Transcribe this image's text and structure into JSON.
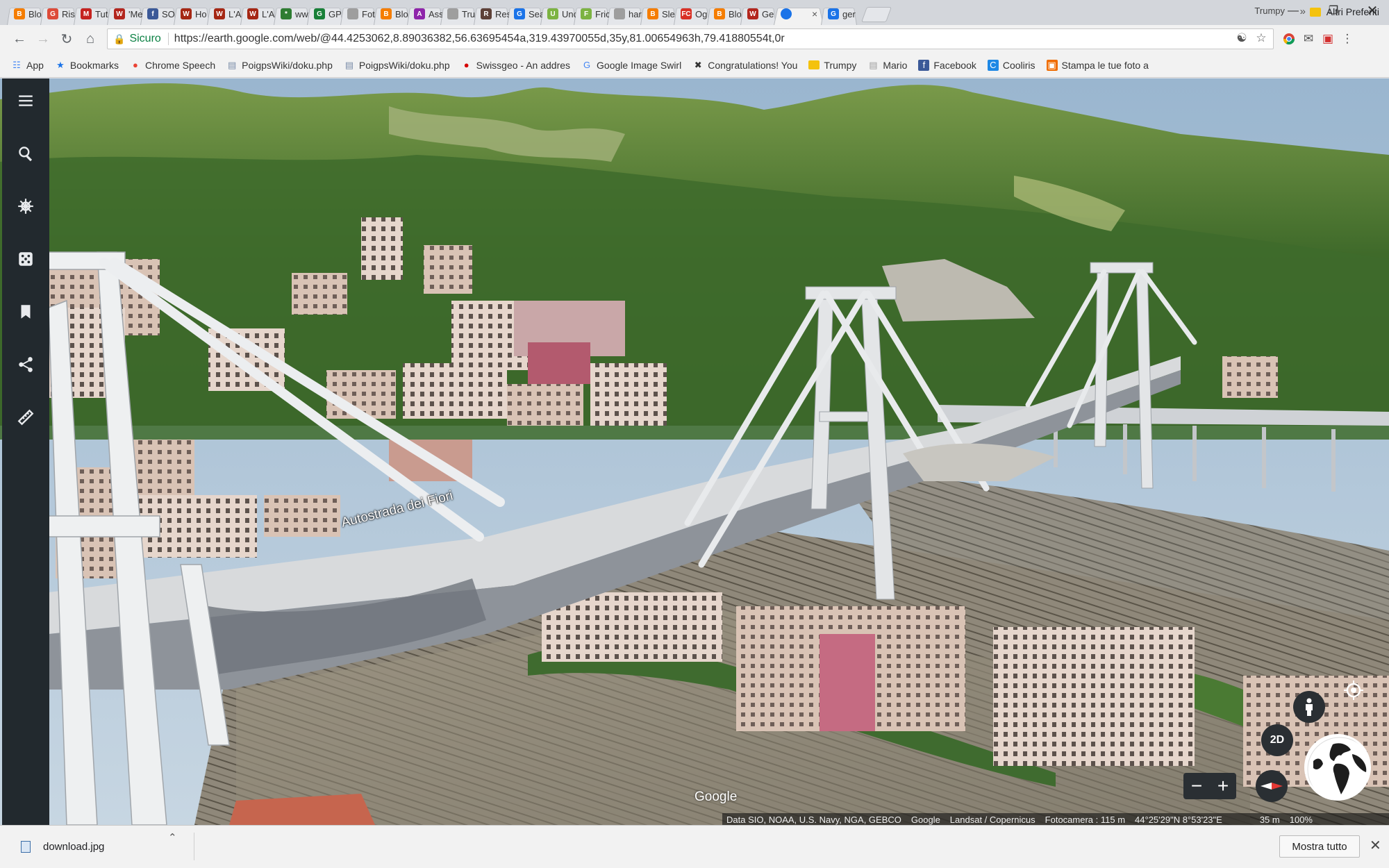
{
  "browser": {
    "tabs": [
      {
        "title": "Blo",
        "icon_color": "#f57d00",
        "icon_letter": "B"
      },
      {
        "title": "Ris",
        "icon_color": "#dd4b39",
        "icon_letter": "G"
      },
      {
        "title": "Tut",
        "icon_color": "#c5221f",
        "icon_letter": "M"
      },
      {
        "title": "'Me",
        "icon_color": "#b3261e",
        "icon_letter": "W"
      },
      {
        "title": "SO",
        "icon_color": "#3b5998",
        "icon_letter": "f"
      },
      {
        "title": "Ho",
        "icon_color": "#a52714",
        "icon_letter": "W"
      },
      {
        "title": "L'A",
        "icon_color": "#a52714",
        "icon_letter": "W"
      },
      {
        "title": "L'A",
        "icon_color": "#a52714",
        "icon_letter": "W"
      },
      {
        "title": "ww",
        "icon_color": "#2e7d32",
        "icon_letter": "*"
      },
      {
        "title": "GP",
        "icon_color": "#188038",
        "icon_letter": "G"
      },
      {
        "title": "Fot",
        "icon_color": "#9e9e9e",
        "icon_letter": ""
      },
      {
        "title": "Blo",
        "icon_color": "#f57d00",
        "icon_letter": "B"
      },
      {
        "title": "Ass",
        "icon_color": "#8e24aa",
        "icon_letter": "A"
      },
      {
        "title": "Tru",
        "icon_color": "#9e9e9e",
        "icon_letter": ""
      },
      {
        "title": "Res",
        "icon_color": "#5d4037",
        "icon_letter": "R"
      },
      {
        "title": "Sea",
        "icon_color": "#1a73e8",
        "icon_letter": "G"
      },
      {
        "title": "Unc",
        "icon_color": "#7cb342",
        "icon_letter": "U"
      },
      {
        "title": "Fric",
        "icon_color": "#7cb342",
        "icon_letter": "F"
      },
      {
        "title": "har",
        "icon_color": "#9e9e9e",
        "icon_letter": ""
      },
      {
        "title": "Sle",
        "icon_color": "#f57d00",
        "icon_letter": "B"
      },
      {
        "title": "Og",
        "icon_color": "#d93025",
        "icon_letter": "FC"
      },
      {
        "title": "Blo",
        "icon_color": "#f57d00",
        "icon_letter": "B"
      },
      {
        "title": "Ge",
        "icon_color": "#b3261e",
        "icon_letter": "W"
      },
      {
        "title": "",
        "icon_color": "#1a73e8",
        "icon_letter": "",
        "active": true
      },
      {
        "title": "ger",
        "icon_color": "#1a73e8",
        "icon_letter": "G"
      }
    ],
    "profile_name": "Trumpy",
    "omnibox": {
      "secure_label": "Sicuro",
      "url": "https://earth.google.com/web/@44.4253062,8.89036382,56.63695454a,319.43970055d,35y,81.00654963h,79.41880554t,0r"
    },
    "bookmarks": [
      {
        "label": "App",
        "icon": "apps-grid-icon",
        "color": "#4285f4"
      },
      {
        "label": "Bookmarks",
        "icon": "star-icon",
        "color": "#1a73e8"
      },
      {
        "label": "Chrome Speech",
        "icon": "chrome-icon",
        "color": "#ea4335"
      },
      {
        "label": "PoigpsWiki/doku.php",
        "icon": "page-icon",
        "color": "#7a8ca8"
      },
      {
        "label": "PoigpsWiki/doku.php",
        "icon": "page-icon",
        "color": "#7a8ca8"
      },
      {
        "label": "Swissgeo - An addres",
        "icon": "red-dot-icon",
        "color": "#d50000"
      },
      {
        "label": "Google Image Swirl",
        "icon": "google-icon",
        "color": "#4285f4"
      },
      {
        "label": "Congratulations! You",
        "icon": "cross-icon",
        "color": "#333333"
      },
      {
        "label": "Trumpy",
        "icon": "folder-icon",
        "color": "#f4c20d"
      },
      {
        "label": "Mario",
        "icon": "page-icon",
        "color": "#9e9e9e"
      },
      {
        "label": "Facebook",
        "icon": "facebook-icon",
        "color": "#3b5998"
      },
      {
        "label": "Cooliris",
        "icon": "cooliris-icon",
        "color": "#1e88e5"
      },
      {
        "label": "Stampa le tue foto a",
        "icon": "photo-icon",
        "color": "#ef6c00"
      }
    ],
    "other_bookmarks": "Altri Preferiti"
  },
  "earth": {
    "road_label": "Autostrada dei Fiori",
    "google_logo": "Google",
    "attribution": {
      "data": "Data SIO, NOAA, U.S. Navy, NGA, GEBCO",
      "google": "Google",
      "imagery": "Landsat / Copernicus",
      "camera": "Fotocamera : 115 m",
      "coords": "44°25'29\"N 8°53'23\"E",
      "scale": "35 m",
      "loaded": "100%"
    },
    "view_mode": "2D",
    "zoom_out": "−",
    "zoom_in": "+"
  },
  "downloads": {
    "file_name": "download.jpg",
    "show_all": "Mostra tutto"
  }
}
